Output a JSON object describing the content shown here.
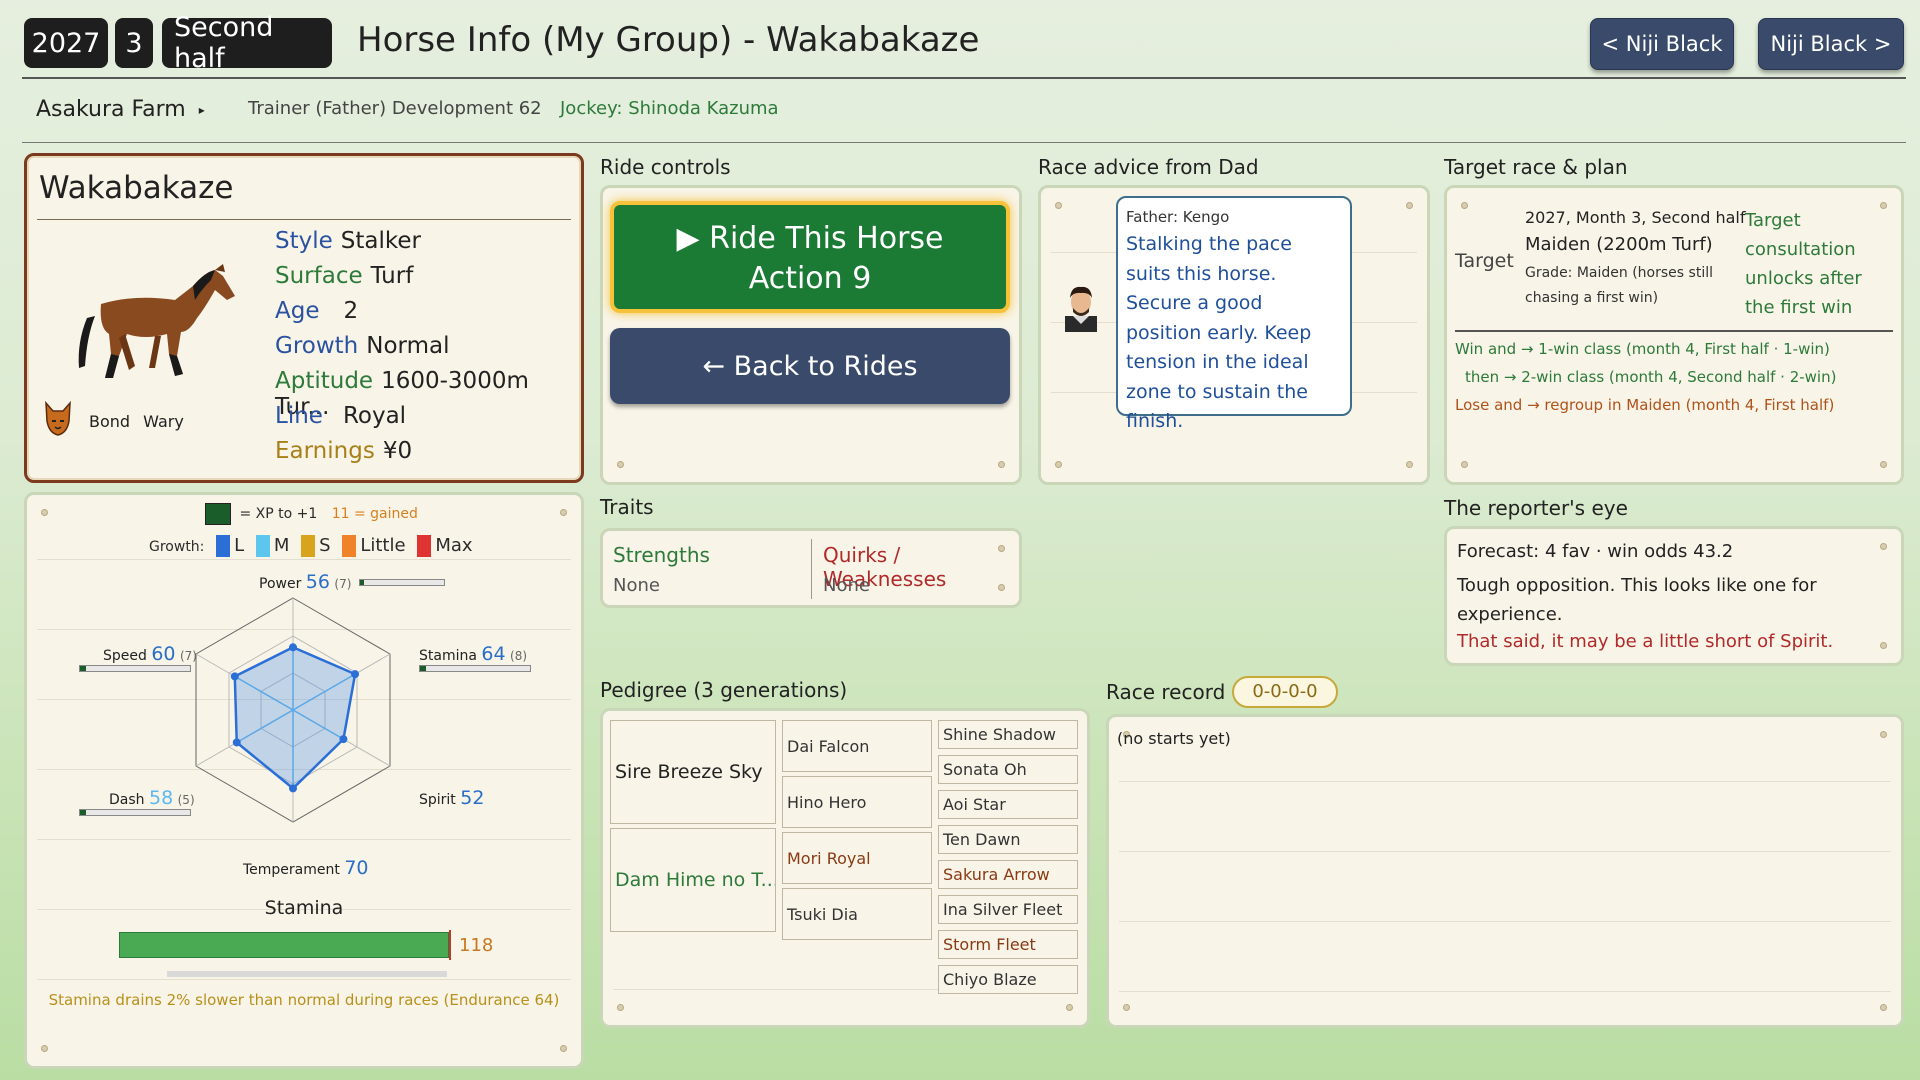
{
  "header": {
    "year": "2027",
    "month": "3",
    "half": "Second half",
    "title": "Horse Info (My Group) - Wakabakaze",
    "prev_button": "< Niji Black",
    "next_button": "Niji Black >"
  },
  "subheader": {
    "farm": "Asakura Farm",
    "trainer": "Trainer (Father) Development 62",
    "jockey": "Jockey: Shinoda Kazuma"
  },
  "horse": {
    "name": "Wakabakaze",
    "tags": [
      "Bond",
      "Wary"
    ],
    "stats": [
      {
        "key": "Style",
        "value": "Stalker"
      },
      {
        "key": "Surface",
        "value": "Turf"
      },
      {
        "key": "Age",
        "value": "2"
      },
      {
        "key": "Growth",
        "value": "Normal"
      },
      {
        "key": "Aptitude",
        "value": "1600-3000m Tur..."
      },
      {
        "key": "Line",
        "value": "Royal"
      },
      {
        "key": "Earnings",
        "value": "¥0"
      }
    ]
  },
  "stats_panel": {
    "legend_xp": "= XP to +1",
    "legend_gained": "11 = gained",
    "growth_label": "Growth:",
    "growth_keys": [
      "L",
      "M",
      "S",
      "Little",
      "Max"
    ],
    "growth_colors": [
      "#2b6fd6",
      "#5cc6ef",
      "#d8a41e",
      "#f0822a",
      "#e03434"
    ],
    "attributes": [
      {
        "name": "Power",
        "value": 56,
        "xp": "(7)",
        "progress": 0.05
      },
      {
        "name": "Stamina",
        "value": 64,
        "xp": "(8)",
        "progress": 0.05
      },
      {
        "name": "Spirit",
        "value": 52,
        "xp": "",
        "progress": 0
      },
      {
        "name": "Temperament",
        "value": 70,
        "xp": "",
        "progress": 0
      },
      {
        "name": "Dash",
        "value": 58,
        "xp": "(5)",
        "progress": 0.05
      },
      {
        "name": "Speed",
        "value": 60,
        "xp": "(7)",
        "progress": 0.05
      }
    ],
    "gauge_title": "Stamina",
    "gauge_value": "118",
    "gauge_fill": 1.0,
    "note": "Stamina drains 2% slower than normal during races (Endurance 64)"
  },
  "ride_controls": {
    "label": "Ride controls",
    "ride_line1": "▶ Ride This Horse",
    "ride_line2": "Action 9",
    "back": "← Back to Rides"
  },
  "traits": {
    "label": "Traits",
    "strengths_title": "Strengths",
    "strengths_value": "None",
    "quirks_title": "Quirks / Weaknesses",
    "quirks_value": "None"
  },
  "advice": {
    "label": "Race advice from Dad",
    "speaker": "Father: Kengo",
    "text": "Stalking the pace suits this horse. Secure a good position early. Keep tension in the ideal zone to sustain the finish."
  },
  "target": {
    "label": "Target race & plan",
    "target_word": "Target",
    "when": "2027, Month 3, Second half",
    "race": "Maiden  (2200m Turf)",
    "grade": "Grade: Maiden (horses still chasing a first win)",
    "note": "Target consultation unlocks after the first win",
    "plan_win": "Win and → 1-win class (month 4, First half · 1-win)",
    "plan_then": "then → 2-win class (month 4, Second half · 2-win)",
    "plan_lose": "Lose and → regroup in Maiden (month 4, First half)"
  },
  "reporter": {
    "label": "The reporter's eye",
    "forecast": "Forecast: 4 fav · win odds 43.2",
    "line1": "Tough opposition. This looks like one for experience.",
    "line2": "That said, it may be a little short of Spirit."
  },
  "pedigree": {
    "label": "Pedigree (3 generations)",
    "sire": "Sire Breeze Sky",
    "dam": "Dam Hime no T...",
    "gen2": [
      "Dai Falcon",
      "Hino Hero",
      "Mori Royal",
      "Tsuki Dia"
    ],
    "gen3": [
      "Shine Shadow",
      "Sonata Oh",
      "Aoi Star",
      "Ten Dawn",
      "Sakura Arrow",
      "Ina Silver Fleet",
      "Storm Fleet",
      "Chiyo Blaze"
    ]
  },
  "record": {
    "label": "Race record",
    "badge": "0-0-0-0",
    "empty": "(no starts yet)"
  }
}
